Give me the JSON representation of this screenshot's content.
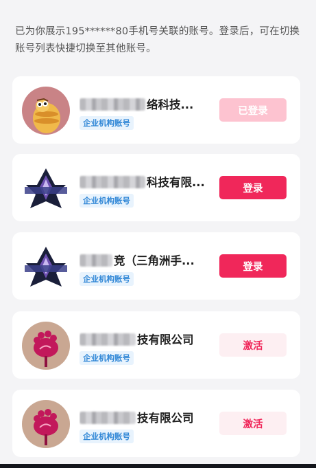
{
  "intro_text": "已为你展示195******80手机号关联的账号。登录后，可在切换账号列表快捷切换至其他账号。",
  "accounts": [
    {
      "name_visible": "络科技...",
      "badge": "企业机构账号",
      "button": "已登录",
      "button_state": "logged-in",
      "avatar": "pancake-mascot"
    },
    {
      "name_visible": "科技有限...",
      "badge": "企业机构账号",
      "button": "登录",
      "button_state": "login",
      "avatar": "star-emblem"
    },
    {
      "name_visible": "竞（三角洲手...",
      "badge": "企业机构账号",
      "button": "登录",
      "button_state": "login",
      "avatar": "star-emblem"
    },
    {
      "name_visible": "技有限公司",
      "badge": "企业机构账号",
      "button": "激活",
      "button_state": "activate",
      "avatar": "raspberry-logo"
    },
    {
      "name_visible": "技有限公司",
      "badge": "企业机构账号",
      "button": "激活",
      "button_state": "activate",
      "avatar": "raspberry-logo"
    }
  ],
  "colors": {
    "accent": "#f0275a",
    "badge_text": "#2f86d6",
    "badge_bg": "#e8f3fd",
    "background": "#f4f4f6"
  }
}
